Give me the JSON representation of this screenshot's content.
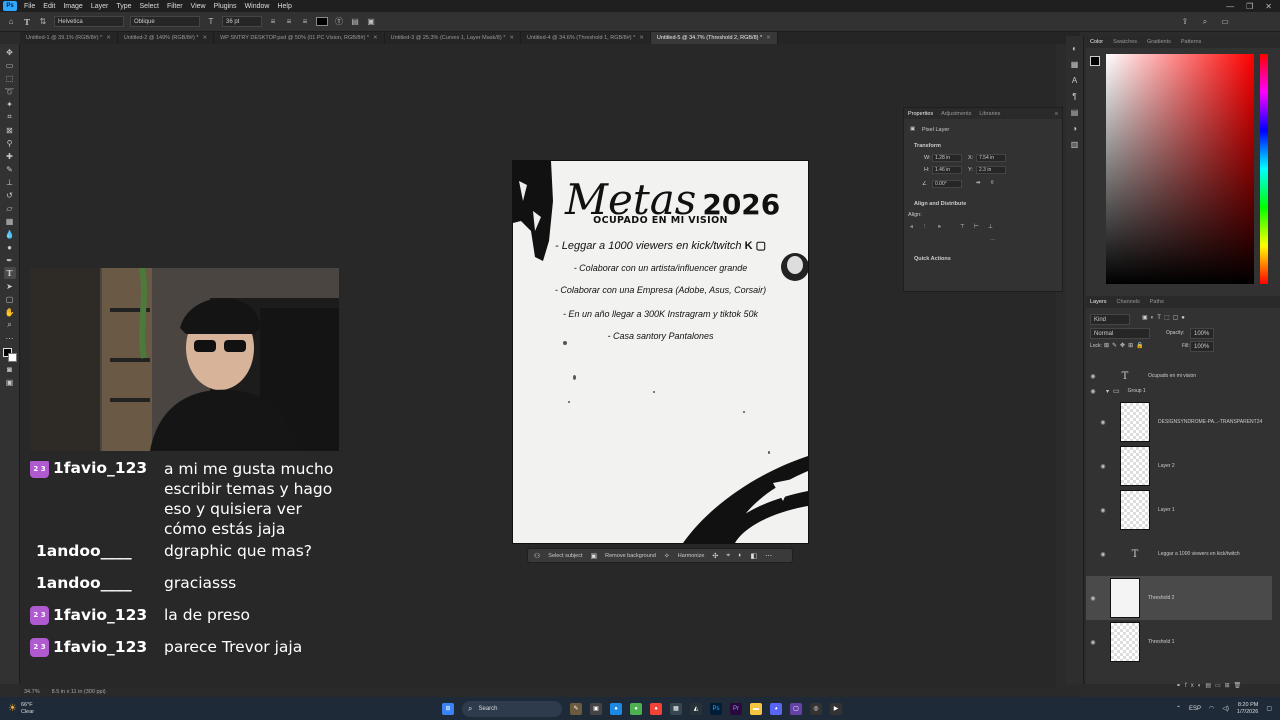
{
  "menu": [
    "File",
    "Edit",
    "Image",
    "Layer",
    "Type",
    "Select",
    "Filter",
    "View",
    "Plugins",
    "Window",
    "Help"
  ],
  "options": {
    "font_family": "Helvetica",
    "font_style": "Oblique",
    "font_size": "36 pt"
  },
  "tabs": [
    {
      "label": "Untitled-1 @ 39.1% (RGB/8#) *",
      "active": false
    },
    {
      "label": "Untitled-2 @ 149% (RGB/8#) *",
      "active": false
    },
    {
      "label": "WP SNTRY DESKTOP.psd @ 50% (01 PC Vision, RGB/8#) *",
      "active": false
    },
    {
      "label": "Untitled-3 @ 25.3% (Curves 1, Layer Mask/8) *",
      "active": false
    },
    {
      "label": "Untitled-4 @ 34.6% (Threshold 1, RGB/8#) *",
      "active": false
    },
    {
      "label": "Untitled-5 @ 34.7% (Threshold 2, RGB/8) *",
      "active": true
    }
  ],
  "document": {
    "title_script": "Metas",
    "title_year": "2026",
    "subtitle": "OCUPADO EN MI VISION",
    "goals": [
      "- Leggar a 1000 viewers en kick/twitch",
      "- Colaborar con un artista/influencer grande",
      "- Colaborar con una Empresa (Adobe, Asus, Corsair)",
      "- En un año llegar a 300K Instragram y tiktok 50k",
      "- Casa santory Pantalones"
    ]
  },
  "contextual_bar": {
    "select_subject": "Select subject",
    "remove_background": "Remove background",
    "harmonize": "Harmonize"
  },
  "chat": [
    {
      "user": "1favio_123",
      "message": "a mi me gusta mucho escribir temas y hago eso y quisiera ver cómo estás jaja",
      "badge": true
    },
    {
      "user": "1andoo____",
      "message": "dgraphic que mas?",
      "badge": false
    },
    {
      "user": "1andoo____",
      "message": "graciasss",
      "badge": false
    },
    {
      "user": "1favio_123",
      "message": "la de preso",
      "badge": true
    },
    {
      "user": "1favio_123",
      "message": "parece Trevor jaja",
      "badge": true
    }
  ],
  "chat_badge_text": "2 3",
  "color_panel": {
    "tabs": [
      "Color",
      "Swatches",
      "Gradients",
      "Patterns"
    ]
  },
  "properties": {
    "tabs": [
      "Properties",
      "Adjustments",
      "Libraries"
    ],
    "kind": "Pixel Layer",
    "transform_label": "Transform",
    "w": "1.28 in",
    "x": "7.54 in",
    "h": "1.46 in",
    "y": "2.3 in",
    "angle": "0.00°",
    "align_label": "Align and Distribute",
    "align_sub": "Align:",
    "quick_actions": "Quick Actions"
  },
  "layers_panel": {
    "tabs": [
      "Layers",
      "Channels",
      "Paths"
    ],
    "kind": "Kind",
    "blend": "Normal",
    "opacity_label": "Opacity:",
    "opacity": "100%",
    "lock_label": "Lock:",
    "fill_label": "Fill:",
    "fill": "100%",
    "layers": [
      {
        "name": "Ocupado en mi vision",
        "type": "text",
        "selected": false
      },
      {
        "name": "Group 1",
        "type": "group",
        "selected": false
      },
      {
        "name": "DESIGNSYNDROME-PA...-TRANSPARENT24",
        "type": "pixel",
        "selected": false
      },
      {
        "name": "Layer 2",
        "type": "pixel",
        "selected": false
      },
      {
        "name": "Layer 1",
        "type": "pixel",
        "selected": false
      },
      {
        "name": "Leggar a 1000 viewers en kick/twitch",
        "type": "text",
        "selected": false
      },
      {
        "name": "Threshold 2",
        "type": "pixel",
        "selected": true
      },
      {
        "name": "Threshold 1",
        "type": "pixel",
        "selected": false
      }
    ]
  },
  "status": {
    "zoom": "34.7%",
    "doc_size": "8.5 in x 11 in (300 ppi)"
  },
  "taskbar": {
    "temp": "66°F",
    "weather": "Clear",
    "search": "Search",
    "lang": "ESP",
    "time": "8:20 PM",
    "date": "1/7/2026"
  }
}
